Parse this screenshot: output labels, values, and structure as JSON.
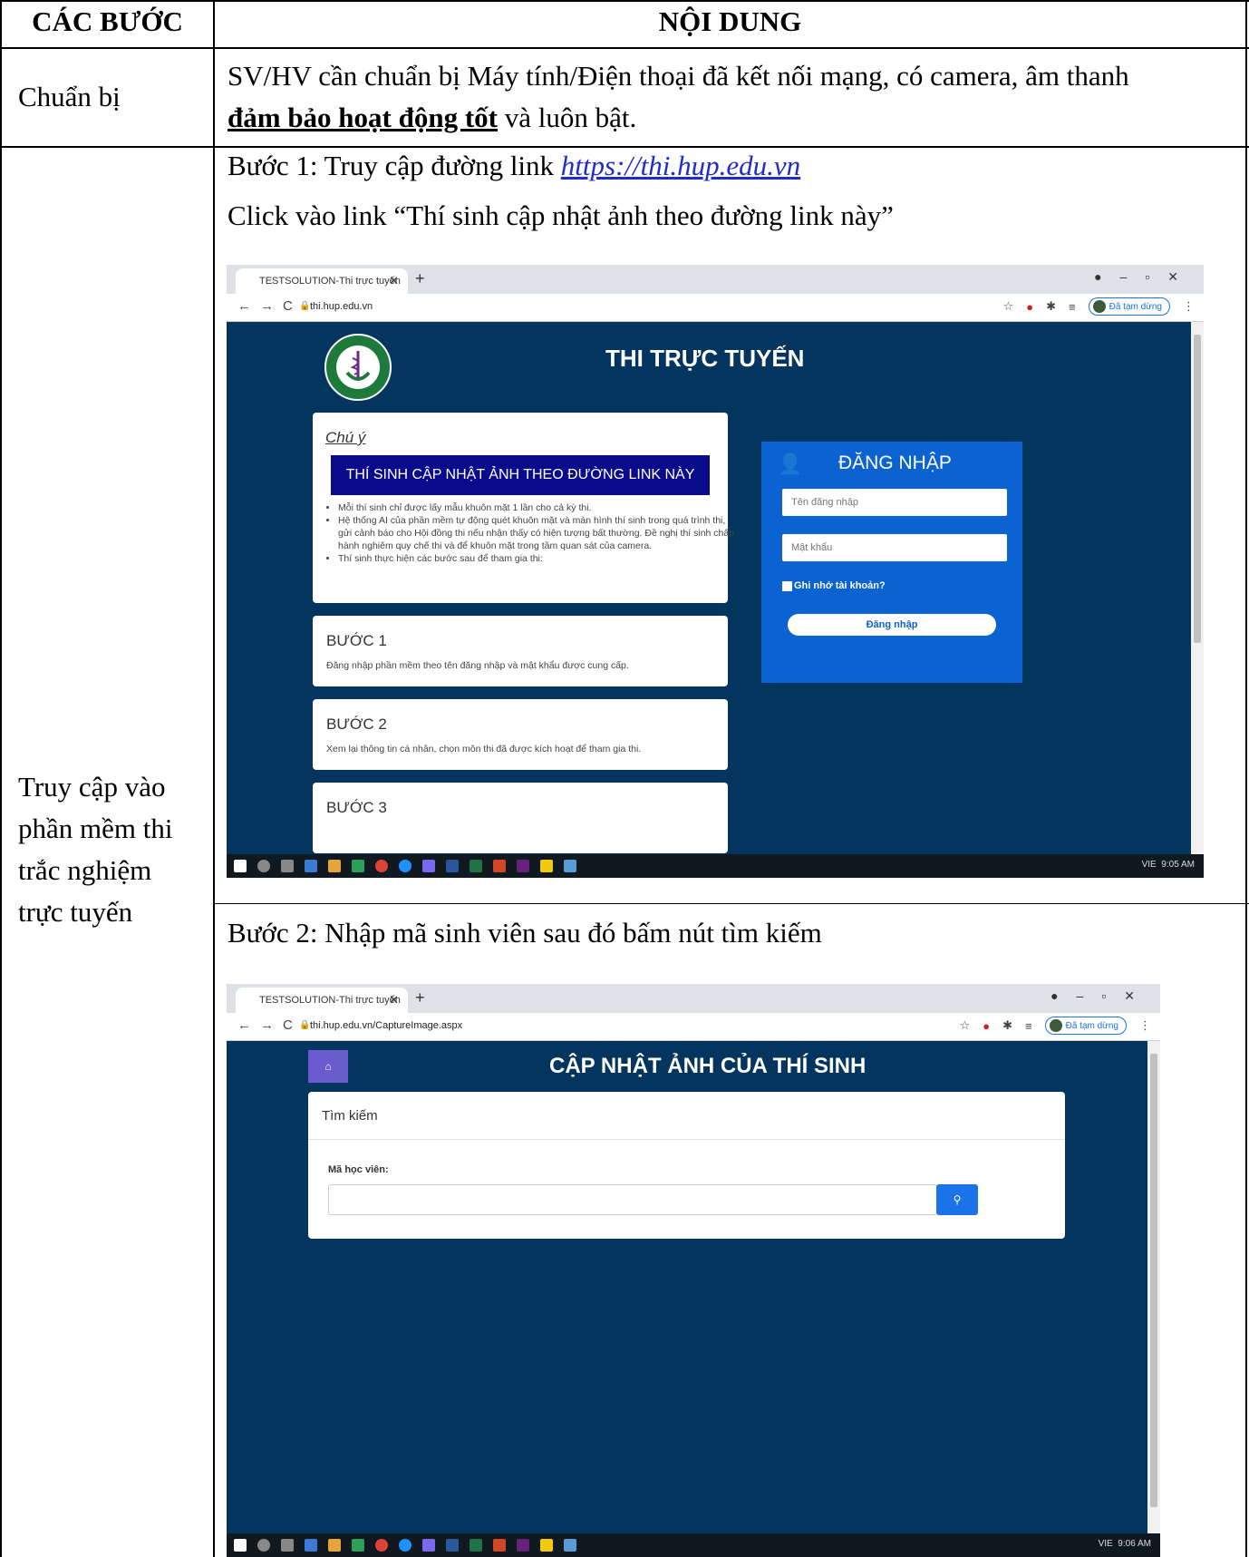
{
  "header": {
    "col1": "CÁC BƯỚC",
    "col2": "NỘI DUNG"
  },
  "row1": {
    "label": "Chuẩn bị",
    "line1": "SV/HV cần chuẩn bị Máy tính/Điện thoại đã kết nối mạng, có camera, âm thanh",
    "emph": "đảm bảo hoạt động tốt",
    "line2_tail": " và luôn bật."
  },
  "row2": {
    "label_lines": [
      "Truy cập vào",
      "phần mềm thi",
      "trắc nghiệm",
      "trực tuyến"
    ],
    "step1_prefix": "Bước 1: Truy cập đường link ",
    "step1_link": "https://thi.hup.edu.vn",
    "step1_line2": "Click vào link “Thí sinh cập nhật ảnh theo đường link này”",
    "step2": "Bước 2: Nhập mã sinh viên sau đó bấm nút tìm kiếm"
  },
  "shot1": {
    "tab_title": "TESTSOLUTION-Thi trực tuyến",
    "url": "thi.hup.edu.vn",
    "paused_label": "Đã tạm dừng",
    "site_title": "THI TRỰC TUYẾN",
    "note_title": "Chú ý",
    "update_photo_button": "THÍ SINH CẬP NHẬT ẢNH THEO ĐƯỜNG LINK NÀY",
    "notes": [
      "Mỗi thí sinh chỉ được lấy mẫu khuôn mặt 1 lần cho cả kỳ thi.",
      "Hệ thống AI của phần mềm tự động quét khuôn mặt và màn hình thí sinh trong quá trình thi, gửi cảnh báo cho Hội đồng thi nếu nhận thấy có hiện tượng bất thường. Đề nghị thí sinh chấp hành nghiêm quy chế thi và để khuôn mặt trong tầm quan sát của camera.",
      "Thí sinh thực hiện các bước sau để tham gia thi:"
    ],
    "steps": [
      {
        "title": "BƯỚC 1",
        "text": "Đăng nhập phần mềm theo tên đăng nhập và mật khẩu được cung cấp."
      },
      {
        "title": "BƯỚC 2",
        "text": "Xem lại thông tin cá nhân, chọn môn thi đã được kích hoạt để tham gia thi."
      },
      {
        "title": "BƯỚC 3",
        "text": ""
      }
    ],
    "login": {
      "title": "ĐĂNG NHẬP",
      "username_placeholder": "Tên đăng nhập",
      "password_placeholder": "Mật khẩu",
      "remember": "Ghi nhớ tài khoản?",
      "submit": "Đăng nhập"
    },
    "tray_time": "9:05 AM",
    "tray_lang": "VIE"
  },
  "shot2": {
    "tab_title": "TESTSOLUTION-Thi trực tuyến",
    "url": "thi.hup.edu.vn/CaptureImage.aspx",
    "paused_label": "Đã tạm dừng",
    "site_title": "CẬP NHẬT ẢNH CỦA THÍ SINH",
    "panel_title": "Tìm kiếm",
    "field_label": "Mã học viên:",
    "field_value": "",
    "tray_time": "9:06 AM",
    "tray_lang": "VIE"
  },
  "colors": {
    "page_bg": "#04355e",
    "login_bg": "#0a63d1",
    "update_btn": "#0a0a8c",
    "search_btn": "#1a73e8",
    "home_btn": "#6a5acd"
  }
}
